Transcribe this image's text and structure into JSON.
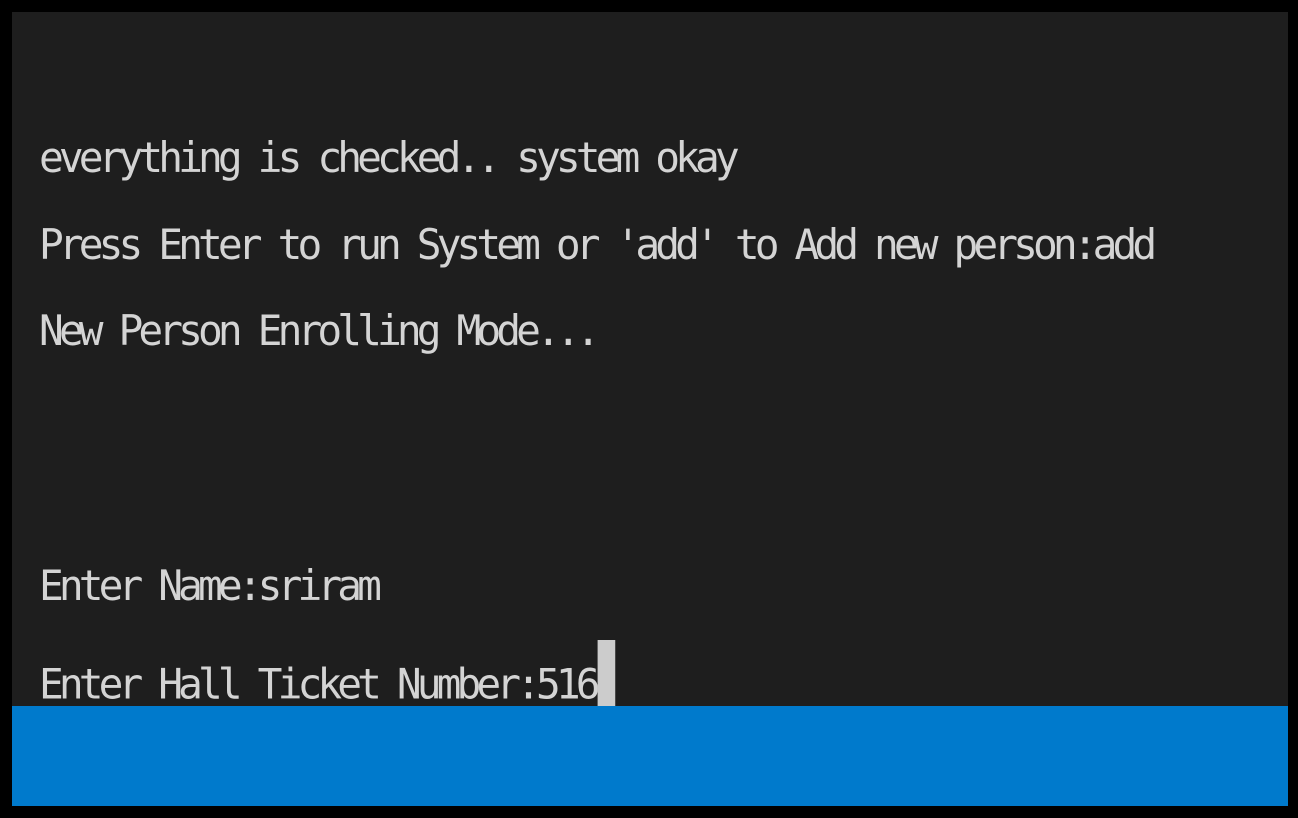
{
  "terminal": {
    "lines": [
      "everything is checked.. system okay",
      "Press Enter to run System or 'add' to Add new person:add",
      "New Person Enrolling Mode...",
      "Enter Name:sriram",
      "Enter Hall Ticket Number:516"
    ]
  },
  "colors": {
    "background": "#1e1e1e",
    "text": "#d4d4d4",
    "cursor": "#cccccc",
    "status_bar": "#007acc",
    "border": "#000000"
  }
}
